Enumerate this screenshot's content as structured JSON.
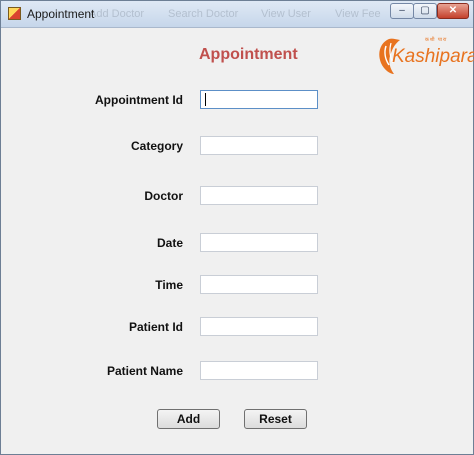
{
  "window": {
    "title": "Appointment",
    "background_titles": [
      "Add Doctor",
      "Search Doctor",
      "View User",
      "View Fee"
    ],
    "controls": {
      "minimize": "–",
      "maximize": "▢",
      "close": "✕"
    }
  },
  "form": {
    "heading": "Appointment",
    "heading_color": "#c0504d",
    "logo_text": "Kashipara",
    "logo_tagline": "कशी पारा",
    "fields": [
      {
        "label": "Appointment Id",
        "value": ""
      },
      {
        "label": "Category",
        "value": ""
      },
      {
        "label": "Doctor",
        "value": ""
      },
      {
        "label": "Date",
        "value": ""
      },
      {
        "label": "Time",
        "value": ""
      },
      {
        "label": "Patient Id",
        "value": ""
      },
      {
        "label": "Patient Name",
        "value": ""
      }
    ],
    "buttons": {
      "add": "Add",
      "reset": "Reset"
    }
  }
}
